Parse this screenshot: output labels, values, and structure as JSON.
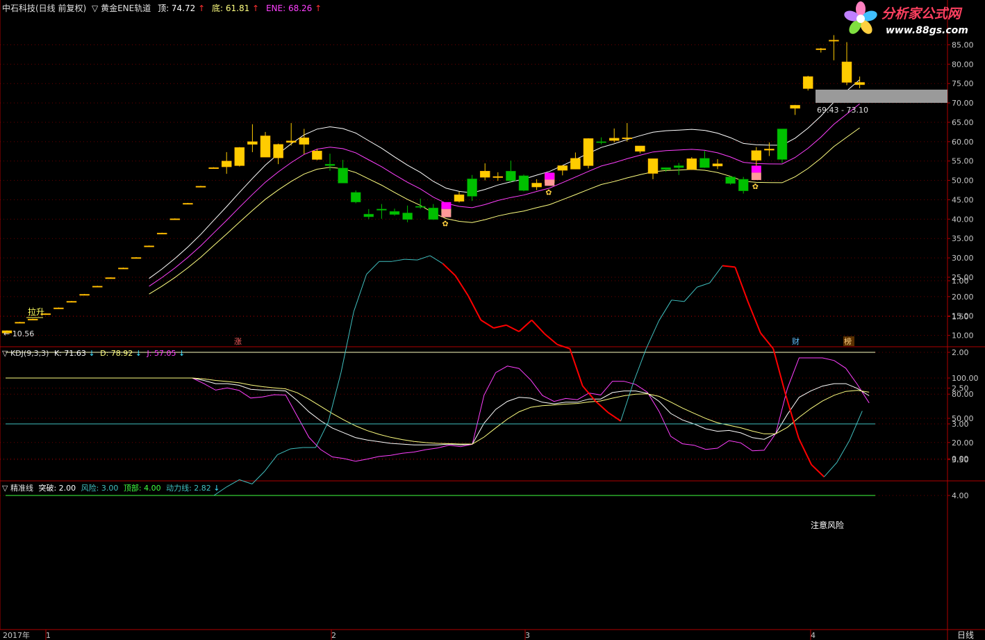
{
  "colors": {
    "grid": "#6e0000",
    "border": "#b00000",
    "axis_text": "#c8c8c8",
    "up": "#ffcc00",
    "down": "#00c000",
    "ene_top": "#ffffff",
    "ene_mid": "#ff40ff",
    "ene_bottom": "#ffff80",
    "signal_pink": "#ff00ff",
    "signal_light": "#ff9999",
    "highlight_box": "#9a9a9a",
    "line_k": "#ffffff",
    "line_d": "#ffff80",
    "line_j": "#ff40ff",
    "line_cyan": "#40c0c0",
    "line_red": "#ff0000",
    "line_green": "#40ff40"
  },
  "main_panel": {
    "name": "中石科技(日线 前复权)",
    "indicator_prefix": "▽",
    "indicator": "黄金ENE轨道",
    "top_label": "顶: ",
    "top_value": "74.72",
    "bottom_label": "底: ",
    "bottom_value": "61.81",
    "ene_label": "ENE: ",
    "ene_value": "68.26",
    "arrow_up": "↑",
    "annotation_lasheng": "拉升",
    "low_label": "← 10.56",
    "range_label": "69.43 - 73.10",
    "marker_zhang": "涨",
    "marker_cai": "财",
    "marker_bang": "榜"
  },
  "kdj_panel": {
    "prefix": "▽",
    "title": "KDJ(9,3,3)",
    "k_label": "K: ",
    "k_value": "71.63",
    "d_label": "D: ",
    "d_value": "78.92",
    "j_label": "J: ",
    "j_value": "57.05",
    "arrow_down": "↓"
  },
  "precision_panel": {
    "prefix": "▽",
    "title": "精准线",
    "tupo_label": "突破: ",
    "tupo_value": "2.00",
    "fengxian_label": "风险: ",
    "fengxian_value": "3.00",
    "dingbu_label": "顶部: ",
    "dingbu_value": "4.00",
    "dongli_label": "动力线: ",
    "dongli_value": "2.82",
    "arrow_down": "↓",
    "risk_note": "注意风险"
  },
  "axes": {
    "price_ticks": [
      "85.00",
      "80.00",
      "75.00",
      "70.00",
      "65.00",
      "60.00",
      "55.00",
      "50.00",
      "45.00",
      "40.00",
      "35.00",
      "30.00",
      "25.00",
      "20.00",
      "15.00",
      "10.00"
    ],
    "kdj_ticks": [
      "100.00",
      "80.00",
      "50.00",
      "20.00",
      "0.00"
    ],
    "precision_ticks": [
      "4.00",
      "3.50",
      "3.00",
      "2.50",
      "2.00",
      "1.50",
      "1.00"
    ],
    "date_labels": [
      "2017年",
      "1",
      "2",
      "3",
      "4"
    ],
    "period": "日线"
  },
  "logo": {
    "title": "分析家公式网",
    "url": "www.88gs.com",
    "icon": "flower-logo-icon"
  },
  "chart_data": {
    "type": "candlestick",
    "price_candles": [
      {
        "o": 10.6,
        "c": 11.2,
        "h": 11.3,
        "l": 10.5
      },
      {
        "o": 13.4,
        "c": 13.4,
        "h": 13.5,
        "l": 13.3
      },
      {
        "o": 14.2,
        "c": 14.2,
        "h": 14.3,
        "l": 14.1
      },
      {
        "o": 15.6,
        "c": 15.6,
        "h": 15.7,
        "l": 15.5
      },
      {
        "o": 17.1,
        "c": 17.1,
        "h": 17.2,
        "l": 17.0
      },
      {
        "o": 18.8,
        "c": 18.8,
        "h": 18.9,
        "l": 18.7
      },
      {
        "o": 20.6,
        "c": 20.6,
        "h": 20.7,
        "l": 20.5
      },
      {
        "o": 22.7,
        "c": 22.7,
        "h": 22.8,
        "l": 22.6
      },
      {
        "o": 24.9,
        "c": 24.9,
        "h": 25.0,
        "l": 24.8
      },
      {
        "o": 27.4,
        "c": 27.4,
        "h": 27.5,
        "l": 27.3
      },
      {
        "o": 30.1,
        "c": 30.1,
        "h": 30.2,
        "l": 30.0
      },
      {
        "o": 33.1,
        "c": 33.1,
        "h": 33.2,
        "l": 33.0
      },
      {
        "o": 36.4,
        "c": 36.4,
        "h": 36.5,
        "l": 36.3
      },
      {
        "o": 40.1,
        "c": 40.1,
        "h": 40.2,
        "l": 40.0
      },
      {
        "o": 44.1,
        "c": 44.1,
        "h": 44.2,
        "l": 44.0
      },
      {
        "o": 48.5,
        "c": 48.5,
        "h": 48.6,
        "l": 48.4
      },
      {
        "o": 53.3,
        "c": 53.3,
        "h": 53.4,
        "l": 53.2
      },
      {
        "o": 53.5,
        "c": 55.0,
        "h": 57.3,
        "l": 51.7
      },
      {
        "o": 53.8,
        "c": 58.5,
        "h": 58.6,
        "l": 53.6
      },
      {
        "o": 59.3,
        "c": 60.0,
        "h": 64.5,
        "l": 57.3
      },
      {
        "o": 56.0,
        "c": 61.5,
        "h": 62.5,
        "l": 56.0
      },
      {
        "o": 55.8,
        "c": 59.3,
        "h": 59.5,
        "l": 54.2
      },
      {
        "o": 59.8,
        "c": 60.2,
        "h": 64.8,
        "l": 59.0
      },
      {
        "o": 59.3,
        "c": 61.0,
        "h": 63.3,
        "l": 56.8
      },
      {
        "o": 55.4,
        "c": 57.6,
        "h": 58.1,
        "l": 55.2
      },
      {
        "o": 54.2,
        "c": 53.8,
        "h": 56.9,
        "l": 52.5
      },
      {
        "o": 53.2,
        "c": 49.3,
        "h": 55.3,
        "l": 49.3
      },
      {
        "o": 46.9,
        "c": 44.4,
        "h": 47.4,
        "l": 44.1
      },
      {
        "o": 41.3,
        "c": 40.6,
        "h": 42.6,
        "l": 40.0
      },
      {
        "o": 42.6,
        "c": 42.3,
        "h": 43.9,
        "l": 40.1
      },
      {
        "o": 42.0,
        "c": 41.2,
        "h": 42.7,
        "l": 40.9
      },
      {
        "o": 41.6,
        "c": 39.9,
        "h": 43.5,
        "l": 39.2
      },
      {
        "o": 43.3,
        "c": 43.2,
        "h": 45.3,
        "l": 42.7
      },
      {
        "o": 42.9,
        "c": 39.9,
        "h": 43.9,
        "l": 39.8
      },
      {
        "o": 43.0,
        "c": 41.6,
        "h": 43.3,
        "l": 41.6
      },
      {
        "o": 44.6,
        "c": 46.3,
        "h": 47.1,
        "l": 44.3
      },
      {
        "o": 50.4,
        "c": 45.9,
        "h": 51.4,
        "l": 44.7
      },
      {
        "o": 50.8,
        "c": 52.4,
        "h": 54.4,
        "l": 50.0
      },
      {
        "o": 51.0,
        "c": 51.0,
        "h": 52.1,
        "l": 49.9
      },
      {
        "o": 52.4,
        "c": 49.9,
        "h": 55.1,
        "l": 49.4
      },
      {
        "o": 51.2,
        "c": 47.4,
        "h": 51.5,
        "l": 47.2
      },
      {
        "o": 48.3,
        "c": 49.3,
        "h": 50.3,
        "l": 47.5
      },
      {
        "o": 49.4,
        "c": 51.8,
        "h": 52.0,
        "l": 48.8
      },
      {
        "o": 52.6,
        "c": 53.8,
        "h": 53.9,
        "l": 51.3
      },
      {
        "o": 52.9,
        "c": 55.7,
        "h": 57.2,
        "l": 52.9
      },
      {
        "o": 53.8,
        "c": 60.8,
        "h": 60.9,
        "l": 53.1
      },
      {
        "o": 60.0,
        "c": 59.8,
        "h": 61.1,
        "l": 59.3
      },
      {
        "o": 60.3,
        "c": 60.9,
        "h": 63.4,
        "l": 59.8
      },
      {
        "o": 60.8,
        "c": 61.0,
        "h": 64.8,
        "l": 60.0
      },
      {
        "o": 57.5,
        "c": 58.9,
        "h": 58.9,
        "l": 57.0
      },
      {
        "o": 51.8,
        "c": 55.6,
        "h": 55.6,
        "l": 50.3
      },
      {
        "o": 53.3,
        "c": 52.8,
        "h": 53.3,
        "l": 52.2
      },
      {
        "o": 53.8,
        "c": 53.3,
        "h": 54.5,
        "l": 51.4
      },
      {
        "o": 52.8,
        "c": 55.6,
        "h": 56.0,
        "l": 52.7
      },
      {
        "o": 55.7,
        "c": 53.3,
        "h": 57.6,
        "l": 53.2
      },
      {
        "o": 53.7,
        "c": 54.3,
        "h": 55.5,
        "l": 52.9
      },
      {
        "o": 50.9,
        "c": 49.2,
        "h": 51.1,
        "l": 48.9
      },
      {
        "o": 50.3,
        "c": 47.3,
        "h": 50.9,
        "l": 46.6
      },
      {
        "o": 55.2,
        "c": 57.7,
        "h": 58.6,
        "l": 53.8
      },
      {
        "o": 57.8,
        "c": 58.1,
        "h": 59.8,
        "l": 56.3
      },
      {
        "o": 63.3,
        "c": 55.4,
        "h": 63.3,
        "l": 54.5
      },
      {
        "o": 68.6,
        "c": 69.4,
        "h": 69.5,
        "l": 66.9
      },
      {
        "o": 73.7,
        "c": 76.8,
        "h": 77.0,
        "l": 73.2
      },
      {
        "o": 84.0,
        "c": 84.0,
        "h": 84.2,
        "l": 83.0
      },
      {
        "o": 86.2,
        "c": 86.2,
        "h": 87.5,
        "l": 81.0
      },
      {
        "o": 75.3,
        "c": 80.6,
        "h": 85.7,
        "l": 74.6
      },
      {
        "o": 74.7,
        "c": 75.3,
        "h": 76.8,
        "l": 73.8
      }
    ],
    "kdj": {
      "k": [
        100,
        100,
        100,
        100,
        100,
        100,
        100,
        100,
        100,
        100,
        100,
        100,
        100,
        100,
        100,
        100,
        100,
        97,
        93,
        93,
        91,
        86,
        85,
        85,
        84,
        72,
        58,
        47,
        38,
        32,
        26,
        23,
        21,
        19,
        18,
        17,
        17,
        17,
        18,
        17,
        18,
        44,
        61,
        71,
        76,
        75,
        70,
        68,
        70,
        70,
        74,
        74,
        82,
        84,
        84,
        81,
        71,
        56,
        48,
        43,
        37,
        34,
        35,
        32,
        26,
        24,
        31,
        55,
        76,
        84,
        90,
        93,
        93,
        87,
        78
      ]
    },
    "dongli": [
      4.0,
      3.88,
      3.78,
      3.84,
      3.66,
      3.43,
      3.35,
      3.33,
      3.33,
      2.97,
      2.28,
      1.43,
      0.91,
      0.73,
      0.73,
      0.7,
      0.71,
      0.65,
      0.76,
      0.93,
      1.21,
      1.55,
      1.66,
      1.62,
      1.71,
      1.55,
      1.74,
      1.89,
      1.95,
      2.47,
      2.68,
      2.84,
      2.96,
      2.42,
      1.95,
      1.56,
      1.27,
      1.29,
      1.09,
      1.03,
      0.79,
      0.81,
      1.29,
      1.73,
      1.95,
      2.61,
      3.2,
      3.57,
      3.74,
      3.54,
      3.23,
      2.82
    ],
    "dongli_red_ranges": [
      [
        18,
        32
      ],
      [
        40,
        48
      ]
    ]
  }
}
